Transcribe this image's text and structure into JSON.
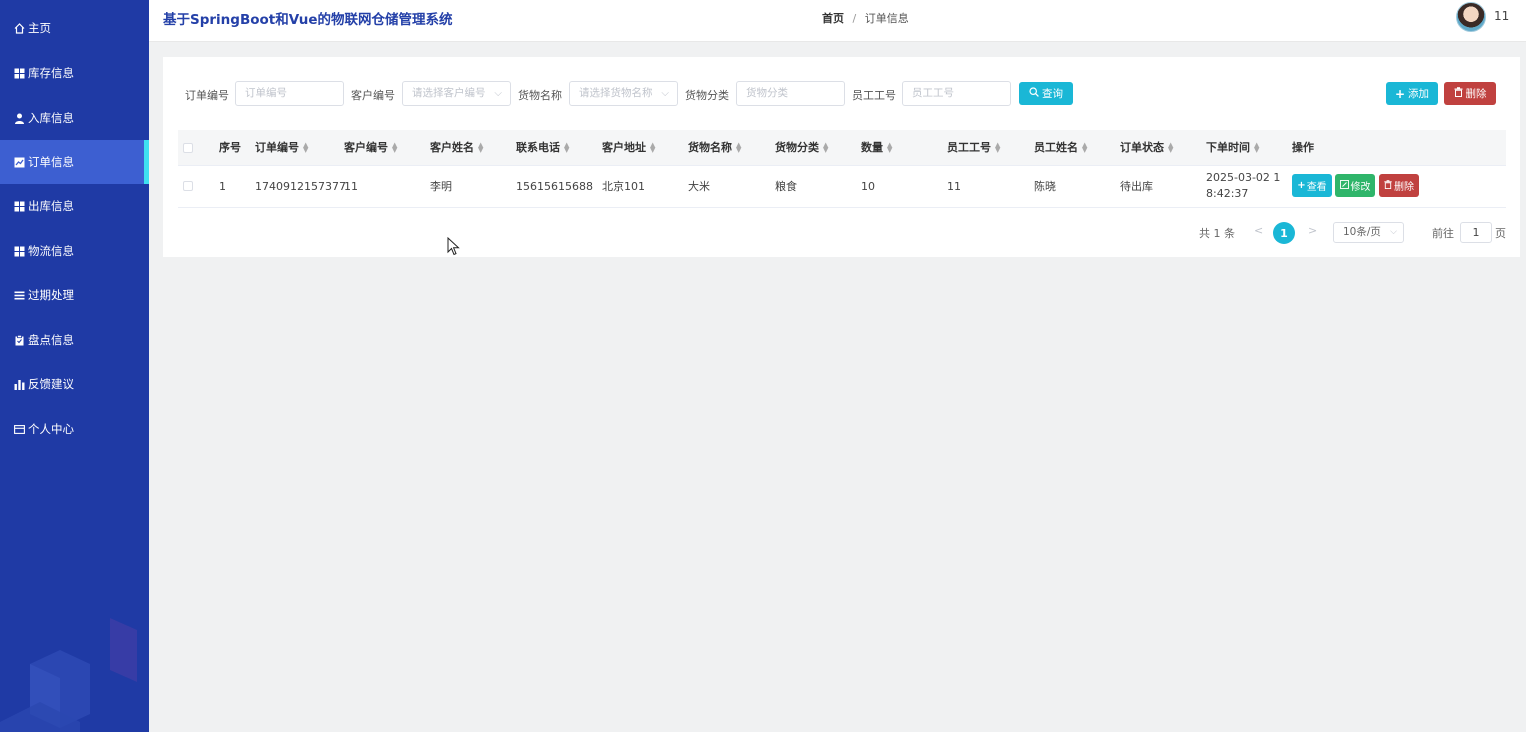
{
  "sidebar": {
    "items": [
      {
        "label": "主页",
        "icon": "home-icon"
      },
      {
        "label": "库存信息",
        "icon": "grid-icon"
      },
      {
        "label": "入库信息",
        "icon": "user-icon"
      },
      {
        "label": "订单信息",
        "icon": "chart-icon",
        "active": true
      },
      {
        "label": "出库信息",
        "icon": "grid-icon"
      },
      {
        "label": "物流信息",
        "icon": "grid-icon"
      },
      {
        "label": "过期处理",
        "icon": "list-icon"
      },
      {
        "label": "盘点信息",
        "icon": "clipboard-icon"
      },
      {
        "label": "反馈建议",
        "icon": "bar-chart-icon"
      },
      {
        "label": "个人中心",
        "icon": "card-icon"
      }
    ]
  },
  "header": {
    "title": "基于SpringBoot和Vue的物联网仓储管理系统",
    "breadcrumb": {
      "home": "首页",
      "separator": "/",
      "current": "订单信息"
    },
    "username": "11"
  },
  "filters": {
    "order_no": {
      "label": "订单编号",
      "placeholder": "订单编号"
    },
    "customer_no": {
      "label": "客户编号",
      "placeholder": "请选择客户编号"
    },
    "goods_name": {
      "label": "货物名称",
      "placeholder": "请选择货物名称"
    },
    "goods_category": {
      "label": "货物分类",
      "placeholder": "货物分类"
    },
    "employee_no": {
      "label": "员工工号",
      "placeholder": "员工工号"
    },
    "search_label": "查询"
  },
  "toolbar": {
    "add_label": "添加",
    "delete_label": "删除"
  },
  "table": {
    "columns": [
      "序号",
      "订单编号",
      "客户编号",
      "客户姓名",
      "联系电话",
      "客户地址",
      "货物名称",
      "货物分类",
      "数量",
      "员工工号",
      "员工姓名",
      "订单状态",
      "下单时间",
      "操作"
    ],
    "rows": [
      {
        "index": "1",
        "order_no": "1740912157377",
        "customer_no": "11",
        "customer_name": "李明",
        "phone": "15615615688",
        "address": "北京101",
        "goods_name": "大米",
        "goods_category": "粮食",
        "quantity": "10",
        "employee_no": "11",
        "employee_name": "陈晓",
        "status": "待出库",
        "order_time": "2025-03-02 18:42:37"
      }
    ],
    "actions": {
      "view": "查看",
      "edit": "修改",
      "delete": "删除"
    }
  },
  "pagination": {
    "total_text": "共 1 条",
    "prev": "<",
    "current_page": "1",
    "next": ">",
    "page_size": "10条/页",
    "goto_label": "前往",
    "goto_value": "1",
    "page_suffix": "页"
  },
  "colors": {
    "sidebar_bg": "#1f3aa5",
    "sidebar_active": "#3d5fd1",
    "sidebar_active_bar": "#3ee0f0",
    "primary": "#1ab7d6",
    "success": "#2fb56a",
    "danger": "#c0413f",
    "title": "#2440a8"
  }
}
